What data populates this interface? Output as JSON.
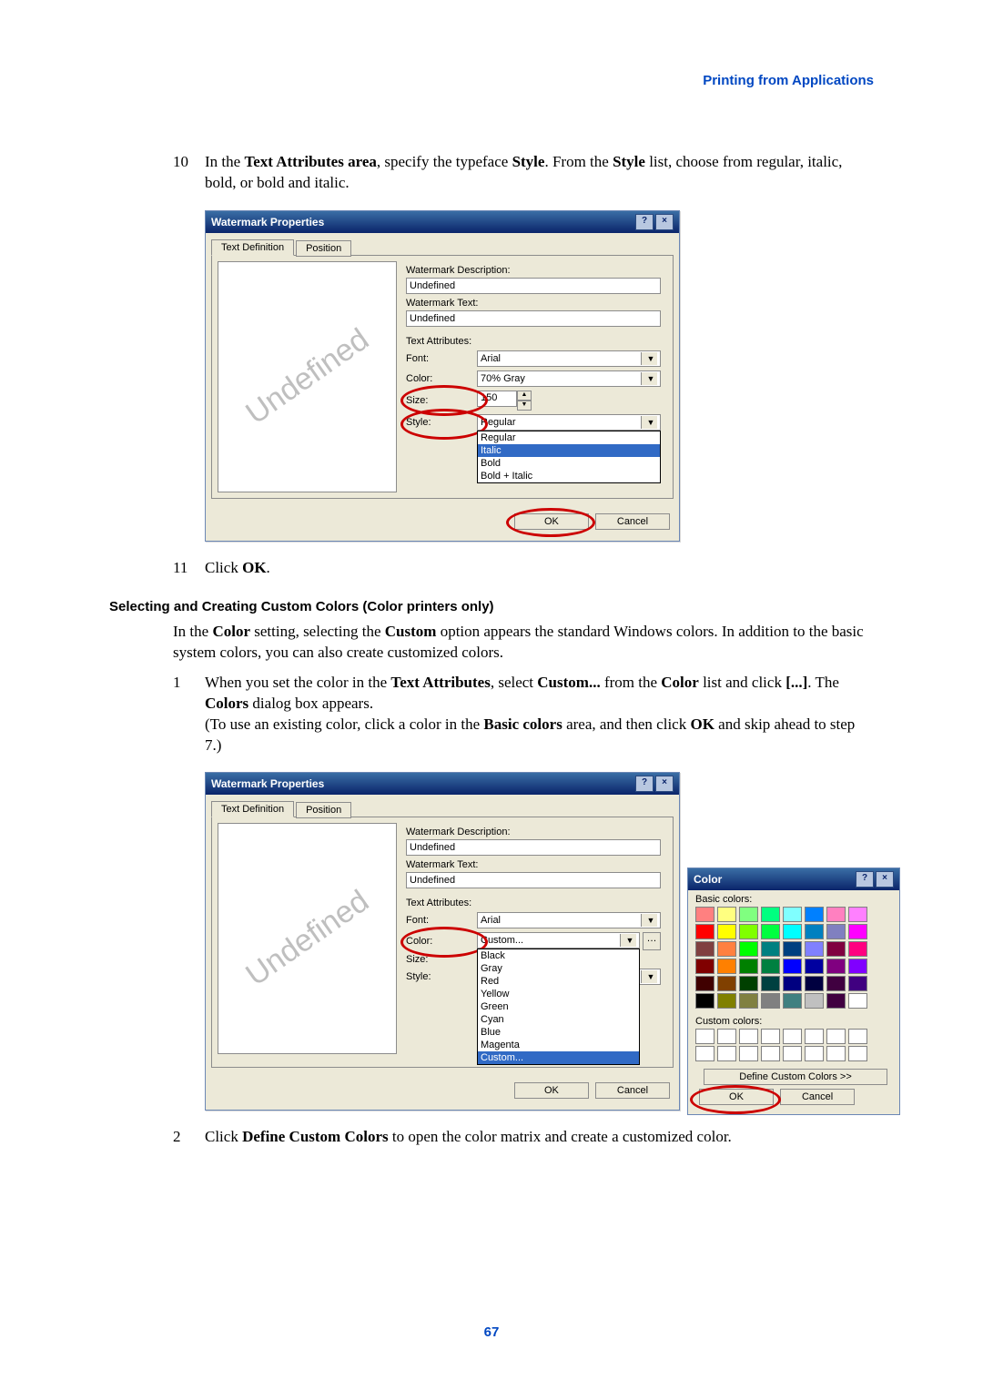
{
  "header": "Printing from Applications",
  "page_number": "67",
  "step10": {
    "num": "10",
    "text_pre": "In the ",
    "b1": "Text Attributes area",
    "mid1": ", specify the typeface ",
    "b2": "Style",
    "mid2": ". From the ",
    "b3": "Style",
    "tail": " list, choose from regular, italic, bold, or bold and italic."
  },
  "dlg1": {
    "title": "Watermark Properties",
    "tabs": [
      "Text Definition",
      "Position"
    ],
    "wm_desc_label": "Watermark Description:",
    "wm_desc_value": "Undefined",
    "wm_text_label": "Watermark Text:",
    "wm_text_value": "Undefined",
    "section": "Text Attributes:",
    "font_label": "Font:",
    "font_value": "Arial",
    "color_label": "Color:",
    "color_value": "70% Gray",
    "size_label": "Size:",
    "size_value": "150",
    "style_label": "Style:",
    "style_value": "Regular",
    "style_opts": [
      "Regular",
      "Italic",
      "Bold",
      "Bold + Italic"
    ],
    "ok": "OK",
    "cancel": "Cancel",
    "preview_text": "Undefined"
  },
  "step11": {
    "num": "11",
    "pre": "Click ",
    "b": "OK",
    "post": "."
  },
  "subhead": "Selecting and Creating Custom Colors (Color printers only)",
  "intro": {
    "pre": "In the ",
    "b1": "Color",
    "mid1": " setting, selecting the ",
    "b2": "Custom",
    "tail": " option appears the standard Windows colors. In addition to the basic system colors, you can also create customized colors."
  },
  "step1": {
    "num": "1",
    "l1_pre": "When you set the color in the ",
    "l1_b1": "Text Attributes",
    "l1_mid1": ", select ",
    "l1_b2": "Custom...",
    "l1_mid2": " from the ",
    "l1_b3": "Color",
    "l1_mid3": " list and click ",
    "l1_b4": "[...]",
    "l1_mid4": ". The ",
    "l1_b5": "Colors",
    "l1_tail": " dialog box appears.",
    "l2_pre": "(To use an existing color, click a color in the ",
    "l2_b1": "Basic colors",
    "l2_mid": " area, and then click ",
    "l2_b2": "OK",
    "l2_tail": " and skip ahead to step 7.)"
  },
  "dlg2": {
    "title": "Watermark Properties",
    "tabs": [
      "Text Definition",
      "Position"
    ],
    "wm_desc_label": "Watermark Description:",
    "wm_desc_value": "Undefined",
    "wm_text_label": "Watermark Text:",
    "wm_text_value": "Undefined",
    "section": "Text Attributes:",
    "font_label": "Font:",
    "font_value": "Arial",
    "color_label": "Color:",
    "color_value": "Custom...",
    "color_opts": [
      "Black",
      "Gray",
      "Red",
      "Yellow",
      "Green",
      "Cyan",
      "Blue",
      "Magenta",
      "Custom..."
    ],
    "size_label": "Size:",
    "style_label": "Style:",
    "ok": "OK",
    "cancel": "Cancel",
    "preview_text": "Undefined"
  },
  "colordlg": {
    "title": "Color",
    "basic_label": "Basic colors:",
    "custom_label": "Custom colors:",
    "define": "Define Custom Colors >>",
    "ok": "OK",
    "cancel": "Cancel",
    "basic_rows": [
      [
        "#ff8080",
        "#ffff80",
        "#80ff80",
        "#00ff80",
        "#80ffff",
        "#0080ff",
        "#ff80c0",
        "#ff80ff"
      ],
      [
        "#ff0000",
        "#ffff00",
        "#80ff00",
        "#00ff40",
        "#00ffff",
        "#0080c0",
        "#8080c0",
        "#ff00ff"
      ],
      [
        "#804040",
        "#ff8040",
        "#00ff00",
        "#008080",
        "#004080",
        "#8080ff",
        "#800040",
        "#ff0080"
      ],
      [
        "#800000",
        "#ff8000",
        "#008000",
        "#008040",
        "#0000ff",
        "#0000a0",
        "#800080",
        "#8000ff"
      ],
      [
        "#400000",
        "#804000",
        "#004000",
        "#004040",
        "#000080",
        "#000040",
        "#400040",
        "#400080"
      ],
      [
        "#000000",
        "#808000",
        "#808040",
        "#808080",
        "#408080",
        "#c0c0c0",
        "#400040",
        "#ffffff"
      ]
    ]
  },
  "step2": {
    "num": "2",
    "pre": "Click ",
    "b": "Define Custom Colors",
    "tail": " to open the color matrix and create a customized color."
  }
}
